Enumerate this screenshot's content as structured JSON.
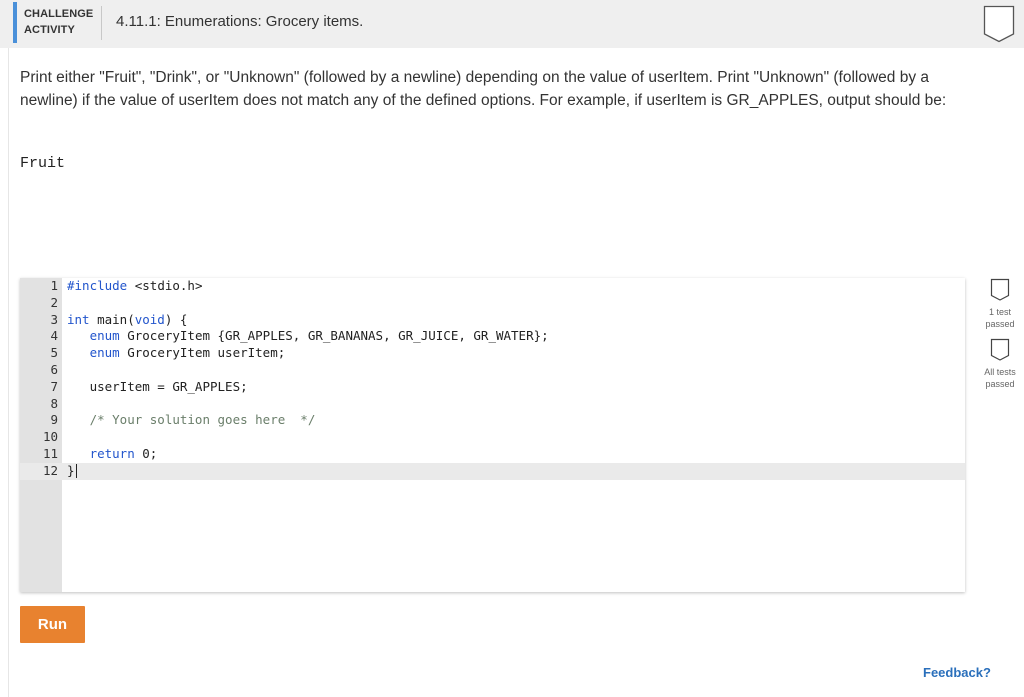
{
  "header": {
    "label_line1": "CHALLENGE",
    "label_line2": "ACTIVITY",
    "title": "4.11.1: Enumerations: Grocery items.",
    "accent_color": "#4a90d9",
    "badge_icon": "completion-badge-icon"
  },
  "instructions": "Print either \"Fruit\", \"Drink\", or \"Unknown\" (followed by a newline) depending on the value of userItem. Print \"Unknown\" (followed by a newline) if the value of userItem does not match any of the defined options. For example, if userItem is GR_APPLES, output should be:",
  "example_output": "Fruit",
  "code": {
    "lines": [
      {
        "n": "1",
        "text": "#include <stdio.h>"
      },
      {
        "n": "2",
        "text": ""
      },
      {
        "n": "3",
        "text": "int main(void) {"
      },
      {
        "n": "4",
        "text": "   enum GroceryItem {GR_APPLES, GR_BANANAS, GR_JUICE, GR_WATER};"
      },
      {
        "n": "5",
        "text": "   enum GroceryItem userItem;"
      },
      {
        "n": "6",
        "text": ""
      },
      {
        "n": "7",
        "text": "   userItem = GR_APPLES;"
      },
      {
        "n": "8",
        "text": ""
      },
      {
        "n": "9",
        "text": "   /* Your solution goes here  */"
      },
      {
        "n": "10",
        "text": ""
      },
      {
        "n": "11",
        "text": "   return 0;"
      },
      {
        "n": "12",
        "text": "}"
      }
    ]
  },
  "tests": {
    "test1_label": "1 test passed",
    "test1_line1": "1 test",
    "test1_line2": "passed",
    "test2_label": "All tests passed",
    "test2_line1": "All tests",
    "test2_line2": "passed"
  },
  "run_label": "Run",
  "run_color": "#e8822f",
  "feedback_label": "Feedback?"
}
